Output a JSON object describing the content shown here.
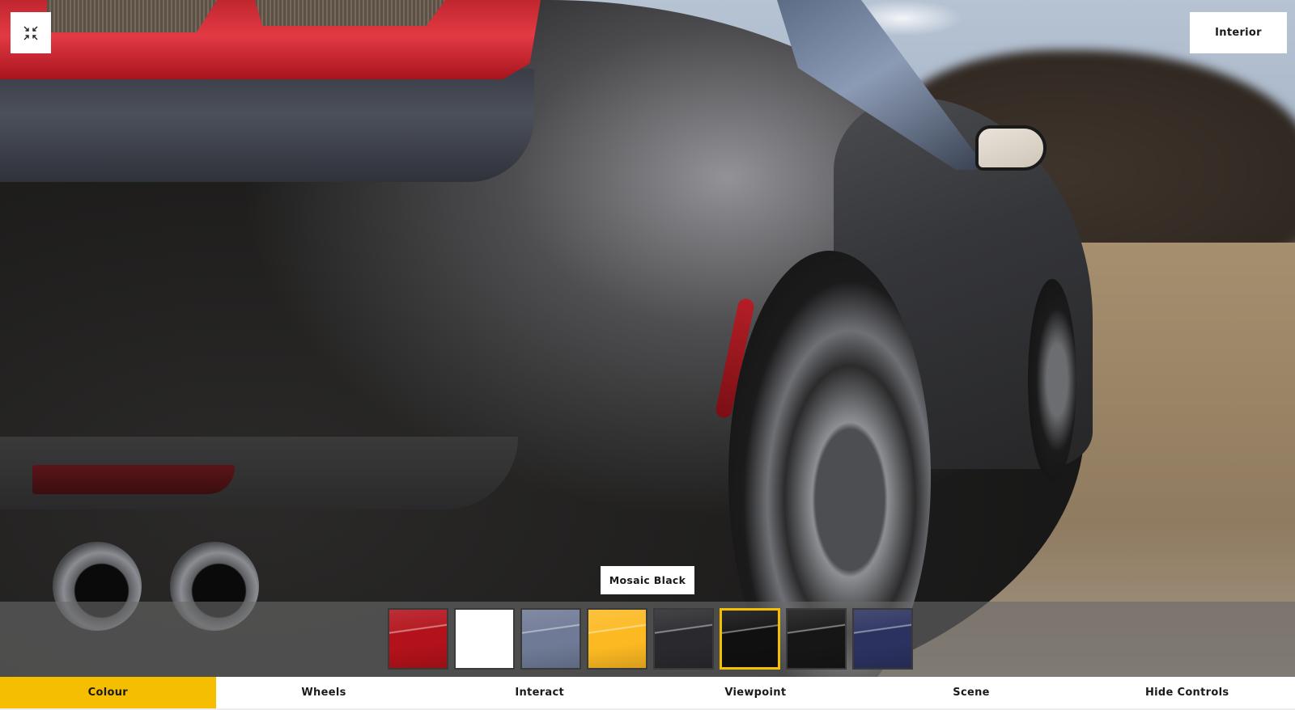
{
  "viewer": {
    "scene_description": "Vehicle exterior 3D render, rear three-quarter view",
    "selected_colour_name": "Mosaic Black",
    "accent_color": "#f5be00"
  },
  "top_controls": {
    "exit_fullscreen": {
      "icon": "collapse-arrows-icon",
      "label": ""
    },
    "interior_button": {
      "label": "Interior"
    }
  },
  "tooltip": {
    "label": "Mosaic Black"
  },
  "colour_swatches": [
    {
      "color": "#b3121a",
      "selected": false
    },
    {
      "color": "#ffffff",
      "selected": false
    },
    {
      "color": "#6f7a96",
      "selected": false
    },
    {
      "color": "#fcb922",
      "selected": false
    },
    {
      "color": "#2a2a2e",
      "selected": false
    },
    {
      "color": "#101010",
      "selected": true,
      "name": "Mosaic Black"
    },
    {
      "color": "#161616",
      "selected": false
    },
    {
      "color": "#2b3260",
      "selected": false
    }
  ],
  "tabs": [
    {
      "label": "Colour",
      "active": true
    },
    {
      "label": "Wheels",
      "active": false
    },
    {
      "label": "Interact",
      "active": false
    },
    {
      "label": "Viewpoint",
      "active": false
    },
    {
      "label": "Scene",
      "active": false
    },
    {
      "label": "Hide Controls",
      "active": false
    }
  ]
}
